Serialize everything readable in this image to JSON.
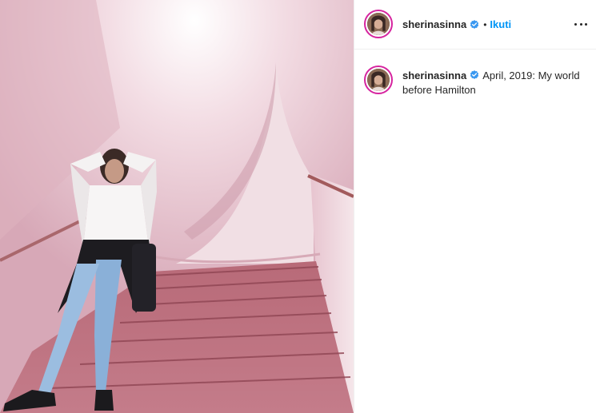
{
  "post": {
    "username": "sherinasinna",
    "verified": true,
    "follow_label": "Ikuti",
    "separator": "•",
    "caption": "April, 2019: My world before Hamilton"
  },
  "icons": {
    "verified": "verified-badge-icon",
    "more": "more-options-icon"
  },
  "colors": {
    "follow": "#0095f6",
    "verified": "#3897f0",
    "story_ring": "#d6249f"
  }
}
